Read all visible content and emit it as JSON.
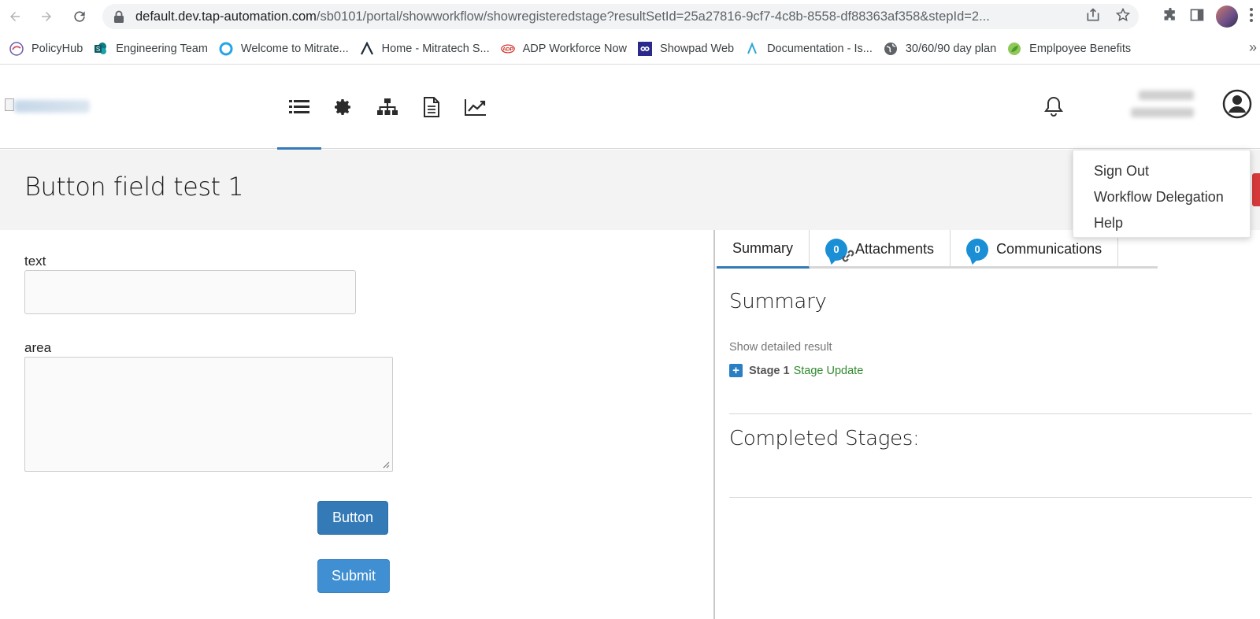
{
  "browser": {
    "url_host": "default.dev.tap-automation.com",
    "url_path": "/sb0101/portal/showworkflow/showregisteredstage?resultSetId=25a27816-9cf7-4c8b-8558-df88363af358&stepId=2...",
    "bookmarks": [
      {
        "label": "PolicyHub",
        "icon": "policyhub-icon"
      },
      {
        "label": "Engineering Team",
        "icon": "sharepoint-icon"
      },
      {
        "label": "Welcome to Mitrate...",
        "icon": "ring-icon"
      },
      {
        "label": "Home - Mitratech S...",
        "icon": "mitratech-icon"
      },
      {
        "label": "ADP Workforce Now",
        "icon": "adp-icon"
      },
      {
        "label": "Showpad Web",
        "icon": "showpad-icon"
      },
      {
        "label": "Documentation - Is...",
        "icon": "mitratech-icon"
      },
      {
        "label": "30/60/90 day plan",
        "icon": "globe-icon"
      },
      {
        "label": "Emplpoyee Benefits",
        "icon": "leaf-icon"
      }
    ],
    "bookmarks_more": "»"
  },
  "page": {
    "title": "Button field test 1"
  },
  "user_menu": {
    "items": [
      "Sign Out",
      "Workflow Delegation",
      "Help"
    ]
  },
  "form": {
    "text_label": "text",
    "area_label": "area",
    "button_label": "Button",
    "submit_label": "Submit"
  },
  "summary_panel": {
    "tabs": [
      {
        "label": "Summary"
      },
      {
        "label": "Attachments",
        "badge": "0"
      },
      {
        "label": "Communications",
        "badge": "0"
      }
    ],
    "heading": "Summary",
    "show_detail": "Show detailed result",
    "stage_number": "Stage 1",
    "stage_link": "Stage Update",
    "completed_heading": "Completed Stages:"
  },
  "colors": {
    "primary": "#337ab7",
    "badge": "#1a8fd6",
    "stage_link": "#2f8a2f",
    "title_bar": "#f3f3f3"
  }
}
